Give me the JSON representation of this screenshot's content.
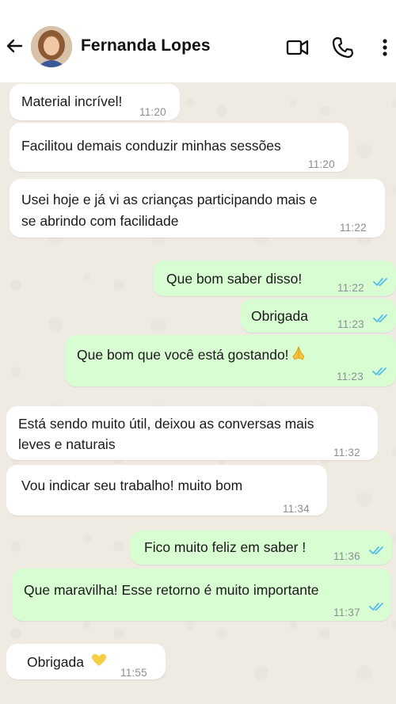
{
  "header": {
    "contact_name": "Fernanda Lopes",
    "back_icon": "arrow-left-icon",
    "video_icon": "video-camera-icon",
    "call_icon": "phone-icon",
    "menu_icon": "more-vertical-icon"
  },
  "colors": {
    "incoming_bubble": "#ffffff",
    "outgoing_bubble": "#d9fdd3",
    "read_ticks": "#53bdeb",
    "chat_background": "#efeae2"
  },
  "messages": [
    {
      "direction": "incoming",
      "text": "Material incrível!",
      "time": "11:20"
    },
    {
      "direction": "incoming",
      "text": "Facilitou demais conduzir minhas sessões",
      "time": "11:20"
    },
    {
      "direction": "incoming",
      "text_line1": "Usei hoje e já vi as crianças participando mais e",
      "text_line2": "se abrindo com facilidade",
      "time": "11:22"
    },
    {
      "direction": "outgoing",
      "text": "Que bom saber disso!",
      "time": "11:22",
      "status": "read"
    },
    {
      "direction": "outgoing",
      "text": "Obrigada",
      "time": "11:23",
      "status": "read"
    },
    {
      "direction": "outgoing",
      "text": "Que bom que você está gostando!",
      "emoji": "folded-hands-icon",
      "time": "11:23",
      "status": "read"
    },
    {
      "direction": "incoming",
      "text_line1": "Está sendo muito útil, deixou as conversas mais",
      "text_line2": "leves e naturais",
      "time": "11:32"
    },
    {
      "direction": "incoming",
      "text": "Vou indicar seu trabalho! muito bom",
      "time": "11:34"
    },
    {
      "direction": "outgoing",
      "text": "Fico muito feliz em saber !",
      "time": "11:36",
      "status": "read"
    },
    {
      "direction": "outgoing",
      "text": "Que maravilha! Esse retorno é muito importante",
      "time": "11:37",
      "status": "read"
    },
    {
      "direction": "incoming",
      "text": "Obrigada",
      "emoji": "yellow-heart-icon",
      "time": "11:55"
    }
  ]
}
